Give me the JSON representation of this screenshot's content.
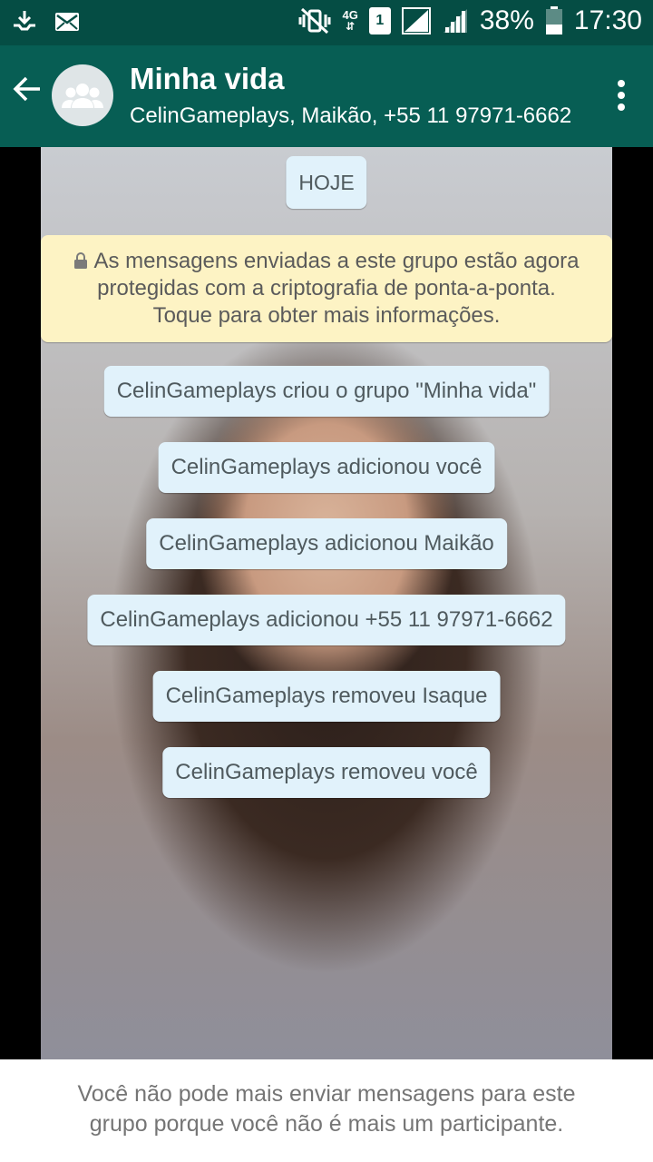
{
  "status_bar": {
    "network_type": "4G",
    "sim_slot": "1",
    "battery": "38%",
    "time": "17:30",
    "icons": [
      "download-icon",
      "mail-icon",
      "mute-vibrate-icon",
      "signal-icon",
      "battery-icon"
    ]
  },
  "header": {
    "title": "Minha vida",
    "subtitle": "CelinGameplays, Maikão, +55 11 97971-6662",
    "avatar_icon": "group-icon"
  },
  "chat": {
    "date_label": "HOJE",
    "encryption_notice": "As mensagens enviadas a este grupo estão agora protegidas com a criptografia de ponta-a-ponta. Toque para obter mais informações.",
    "system_messages": [
      "CelinGameplays criou o grupo \"Minha vida\"",
      "CelinGameplays adicionou você",
      "CelinGameplays adicionou Maikão",
      "CelinGameplays adicionou +55 11 97971-6662",
      "CelinGameplays removeu Isaque",
      "CelinGameplays removeu você"
    ]
  },
  "footer": {
    "line1": "Você não pode mais enviar mensagens para este",
    "line2": "grupo porque você não é mais um participante."
  },
  "colors": {
    "status_bar": "#054d44",
    "app_bar": "#075e54",
    "system_bubble": "#e1f2fb",
    "notice_bubble": "#fdf3c4"
  }
}
